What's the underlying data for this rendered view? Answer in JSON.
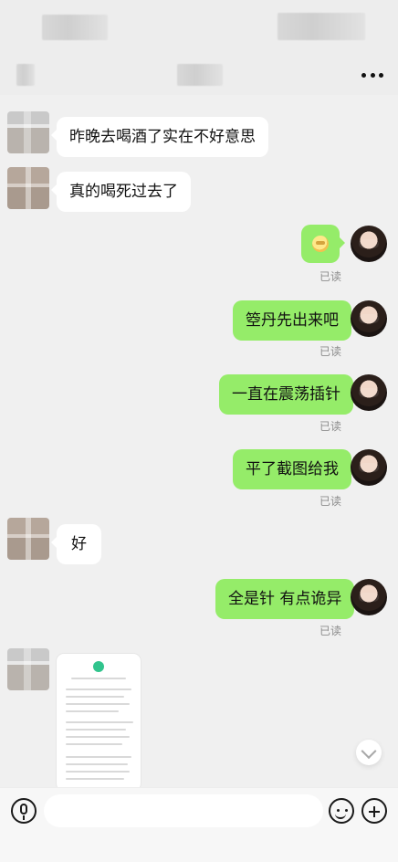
{
  "header": {
    "more_menu_glyph": "⋯"
  },
  "messages": {
    "left_1": "昨晚去喝酒了实在不好意思",
    "left_2": "真的喝死过去了",
    "right_2": "箜丹先出来吧",
    "right_3": "一直在震荡插针",
    "right_4": "平了截图给我",
    "left_3": "好",
    "right_5": "全是针 有点诡异",
    "read_receipt": "已读"
  },
  "input": {
    "placeholder": "",
    "value": ""
  },
  "icons": {
    "mic": "mic-icon",
    "emoji": "emoji-icon",
    "plus": "plus-icon",
    "chevron_down": "chevron-down-icon",
    "more": "more-icon"
  },
  "colors": {
    "bg": "#ededed",
    "chat_bg": "#f0f0f0",
    "bubble_in": "#ffffff",
    "bubble_out": "#95ec69",
    "read_text": "#8c8c8c"
  }
}
